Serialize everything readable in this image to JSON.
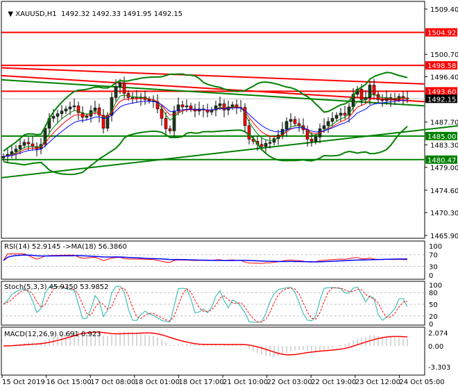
{
  "header": {
    "symbol": "XAUUSD,H1",
    "open": "1492.32",
    "high": "1492.33",
    "low": "1491.95",
    "close": "1492.15"
  },
  "colors": {
    "bull": "#1e3a1e",
    "bear": "#ff0000",
    "resistance": "#ff0000",
    "support": "#008000",
    "current": "#000000",
    "ma_red": "#ff0000",
    "ma_blue": "#0000ff",
    "ma_green": "#008000",
    "stoch_main": "#20b2aa",
    "macd_hist": "#b0b0b0"
  },
  "chart_data": {
    "type": "candlestick",
    "title": "XAUUSD,H1",
    "price_axis": {
      "min": 1465.9,
      "max": 1509.4,
      "ticks": [
        "1509.40",
        "1500.70",
        "1496.40",
        "1487.70",
        "1483.30",
        "1479.00",
        "1474.60",
        "1470.30",
        "1465.90"
      ]
    },
    "level_labels": [
      {
        "value": "1504.92",
        "color": "#ff0000"
      },
      {
        "value": "1498.58",
        "color": "#ff0000"
      },
      {
        "value": "1493.60",
        "color": "#ff0000"
      },
      {
        "value": "1492.15",
        "color": "#000000"
      },
      {
        "value": "1485.00",
        "color": "#008000"
      },
      {
        "value": "1480.47",
        "color": "#008000"
      }
    ],
    "sloping_lines": [
      {
        "color": "#ff0000",
        "from": 1498.1,
        "to": 1495.0
      },
      {
        "color": "#ff0000",
        "from": 1496.6,
        "to": 1491.6
      },
      {
        "color": "#008000",
        "from": 1495.8,
        "to": 1490.8
      },
      {
        "color": "#008000",
        "from": 1477.0,
        "to": 1486.3
      }
    ],
    "closes": [
      1481.1,
      1481.5,
      1482.0,
      1482.5,
      1483.2,
      1483.8,
      1483.5,
      1483.0,
      1482.5,
      1483.4,
      1486.5,
      1488.4,
      1488.8,
      1489.3,
      1489.8,
      1490.2,
      1490.6,
      1490.8,
      1489.5,
      1488.6,
      1488.8,
      1489.9,
      1490.4,
      1489.0,
      1486.5,
      1489.0,
      1492.4,
      1494.5,
      1495.2,
      1493.2,
      1492.4,
      1492.4,
      1492.2,
      1492.5,
      1492.0,
      1491.8,
      1491.6,
      1490.2,
      1488.4,
      1486.4,
      1486.0,
      1489.8,
      1491.0,
      1490.6,
      1490.8,
      1490.2,
      1489.8,
      1490.2,
      1490.0,
      1489.6,
      1490.0,
      1490.8,
      1491.2,
      1490.0,
      1490.6,
      1491.0,
      1490.4,
      1490.5,
      1487.0,
      1484.4,
      1484.0,
      1483.4,
      1483.0,
      1483.6,
      1483.8,
      1484.5,
      1485.2,
      1486.3,
      1487.8,
      1488.2,
      1487.4,
      1487.0,
      1486.2,
      1484.4,
      1484.0,
      1484.8,
      1486.4,
      1487.0,
      1487.8,
      1488.4,
      1489.0,
      1489.4,
      1489.0,
      1490.6,
      1493.0,
      1494.0,
      1492.0,
      1492.4,
      1494.8,
      1493.0,
      1492.0,
      1491.8,
      1492.4,
      1492.0,
      1492.1,
      1492.6,
      1492.3,
      1492.15
    ],
    "time_labels": [
      "15 Oct 2019",
      "16 Oct 15:00",
      "17 Oct 08:00",
      "18 Oct 01:00",
      "18 Oct 17:00",
      "21 Oct 10:00",
      "22 Oct 03:00",
      "22 Oct 19:00",
      "23 Oct 12:00",
      "24 Oct 05:00"
    ],
    "rsi": {
      "label": "RSI(14) 52.9145  ->MA(18) 56.3860",
      "ticks": [
        "100",
        "70",
        "30",
        "0"
      ]
    },
    "stoch": {
      "label": "Stoch(5,3,3) 45.9350 53.9852",
      "ticks": [
        "100",
        "80",
        "50",
        "20",
        "0"
      ]
    },
    "macd": {
      "label": "MACD(12,26,9) 0.691 0.923",
      "ticks": [
        "2.074",
        "0.00",
        "-3.303"
      ]
    }
  }
}
